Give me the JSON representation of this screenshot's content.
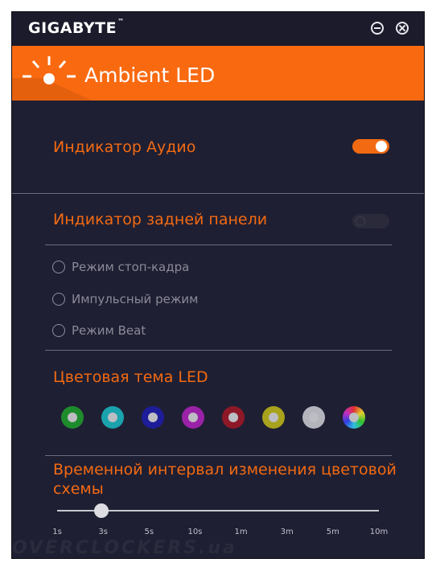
{
  "app": {
    "brand": "GIGABYTE",
    "trademark": "™",
    "accent_color": "#f26a12"
  },
  "titlebar": {
    "minimize_icon": "circle-minus-icon",
    "close_icon": "circle-x-icon"
  },
  "header": {
    "title": "Ambient LED",
    "icon": "led-sun-icon"
  },
  "audio": {
    "label": "Индикатор Аудио",
    "enabled": true
  },
  "rear_panel": {
    "label": "Индикатор задней панели",
    "enabled": false,
    "modes": [
      {
        "label": "Режим стоп-кадра",
        "selected": false
      },
      {
        "label": "Импульсный режим",
        "selected": false
      },
      {
        "label": "Режим Beat",
        "selected": false
      }
    ]
  },
  "color_theme": {
    "label": "Цветовая тема LED",
    "swatches": [
      {
        "name": "green",
        "color": "#1e8c2c"
      },
      {
        "name": "cyan",
        "color": "#1aa2ad"
      },
      {
        "name": "blue",
        "color": "#1d1d9a"
      },
      {
        "name": "purple",
        "color": "#9a22a8"
      },
      {
        "name": "red",
        "color": "#8e1828"
      },
      {
        "name": "yellow",
        "color": "#a8a21c"
      },
      {
        "name": "white",
        "color": "#b4b4bd"
      },
      {
        "name": "rainbow",
        "color": "multicolor"
      }
    ]
  },
  "interval": {
    "label": "Временной интервал изменения цветовой схемы",
    "ticks": [
      "1s",
      "3s",
      "5s",
      "10s",
      "1m",
      "3m",
      "5m",
      "10m"
    ],
    "selected": "3s"
  },
  "watermark": "OVERCLOCKERS.ua"
}
